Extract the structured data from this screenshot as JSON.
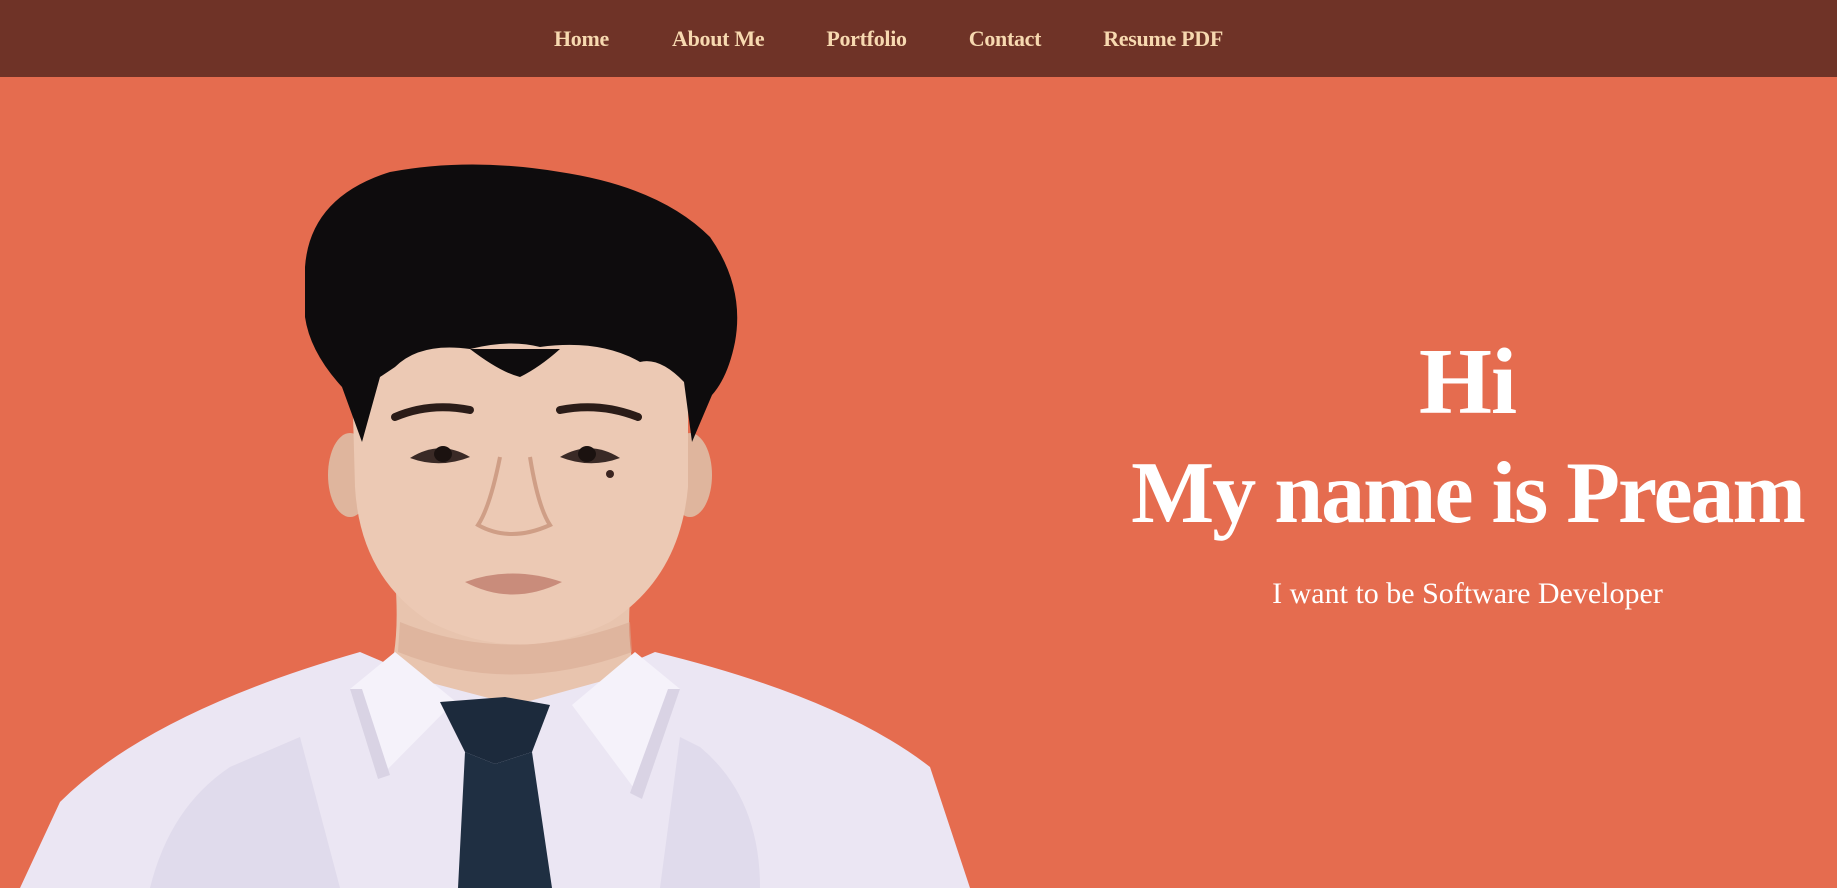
{
  "nav": {
    "items": [
      {
        "label": "Home"
      },
      {
        "label": "About Me"
      },
      {
        "label": "Portfolio"
      },
      {
        "label": "Contact"
      },
      {
        "label": "Resume PDF"
      }
    ]
  },
  "hero": {
    "greeting": "Hi",
    "name_line": "My name is Pream",
    "tagline": "I want to be Software Developer"
  },
  "colors": {
    "nav_background": "#6f3327",
    "nav_text": "#f7d9b0",
    "hero_background": "#e56c4f",
    "hero_text": "#ffffff"
  }
}
